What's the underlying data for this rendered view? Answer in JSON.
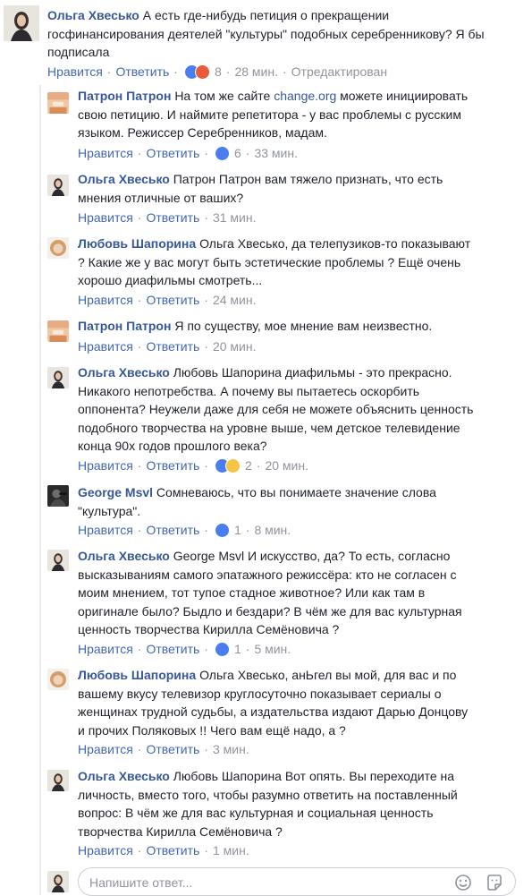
{
  "main_comment": {
    "author": "Ольга Хвесько",
    "lines": [
      "А есть где-нибудь петиция о прекращении",
      "госфинансирования деятелей \"культуры\" подобных серебренникову? Я бы",
      "подписала"
    ],
    "like": "Нравится",
    "reply": "Ответить",
    "reactions": [
      "like-icon",
      "angry-icon"
    ],
    "reaction_count": "8",
    "time": "28 мин.",
    "edited": "Отредактирован"
  },
  "replies": [
    {
      "author": "Патрон Патрон",
      "line1_pre": "На том же сайте ",
      "line1_link": "change.org",
      "line1_post": " можете инициировать",
      "lines": [
        "свою петицию. И наймите репетитора - у вас проблемы с русским",
        "языком. Режиссер Серебренников, мадам."
      ],
      "like": "Нравится",
      "reply": "Ответить",
      "reactions": [
        "like-icon"
      ],
      "reaction_count": "6",
      "time": "33 мин."
    },
    {
      "author": "Ольга Хвесько",
      "lines": [
        "Патрон Патрон вам тяжело признать, что есть",
        "мнения отличные от ваших?"
      ],
      "like": "Нравится",
      "reply": "Ответить",
      "time": "31 мин."
    },
    {
      "author": "Любовь Шапорина",
      "lines": [
        "Ольга Хвесько, да телепузиков-то показывают",
        "? Какие же у вас могут быть эстетические проблемы ? Ещё очень",
        "хорошо диафильмы смотреть..."
      ],
      "like": "Нравится",
      "reply": "Ответить",
      "time": "24 мин."
    },
    {
      "author": "Патрон Патрон",
      "lines": [
        "Я по существу, мое мнение вам неизвестно."
      ],
      "like": "Нравится",
      "reply": "Ответить",
      "time": "20 мин."
    },
    {
      "author": "Ольга Хвесько",
      "lines": [
        "Любовь Шапорина диафильмы - это прекрасно.",
        "Никакого непотребства. А почему вы пытаетесь оскорбить",
        "оппонента? Неужели даже для себя не можете объяснить ценность",
        "подобного творчества на уровне выше, чем детское телевидение",
        "конца 90х годов прошлого века?"
      ],
      "like": "Нравится",
      "reply": "Ответить",
      "reactions": [
        "like-icon",
        "haha-icon"
      ],
      "reaction_count": "2",
      "time": "20 мин."
    },
    {
      "author": "George Msvl",
      "lines": [
        "Сомневаюсь, что вы понимаете значение слова",
        "\"культура\"."
      ],
      "like": "Нравится",
      "reply": "Ответить",
      "reactions": [
        "like-icon"
      ],
      "reaction_count": "1",
      "time": "8 мин."
    },
    {
      "author": "Ольга Хвесько",
      "lines": [
        "George Msvl И искусство, да? То есть, согласно",
        "высказываниям самого эпатажного режиссёра: кто не согласен с",
        "моим мнением, тот тупое стадное животное? Или как там в",
        "оригинале было? Быдло и бездари? В чём же для вас культурная",
        "ценность творчества Кирилла Семёновича ?"
      ],
      "like": "Нравится",
      "reply": "Ответить",
      "reactions": [
        "like-icon"
      ],
      "reaction_count": "1",
      "time": "5 мин."
    },
    {
      "author": "Любовь Шапорина",
      "lines": [
        "Ольга Хвесько, анЬгел вы мой, для вас и по",
        "вашему вкусу телевизор круглосуточно показывает сериалы о",
        "женщинах трудной судьбы, а издательства издают Дарью Донцову",
        "и прочих Поляковых !! Чего вам ещё надо, а ?"
      ],
      "like": "Нравится",
      "reply": "Ответить",
      "time": "3 мин."
    },
    {
      "author": "Ольга Хвесько",
      "lines": [
        "Любовь Шапорина Вот опять. Вы переходите на",
        "личность, вместо того, чтобы разумно ответить на поставленный",
        "вопрос: В чём же для вас культурная и социальная ценность",
        "творчества Кирилла Семёновича ?"
      ],
      "like": "Нравится",
      "reply": "Ответить",
      "time": "1 мин."
    }
  ],
  "reply_box": {
    "placeholder": "Напишите ответ..."
  },
  "colors": {
    "link": "#365899",
    "action": "#4267b2",
    "muted": "#90949c",
    "text": "#1d2129"
  }
}
